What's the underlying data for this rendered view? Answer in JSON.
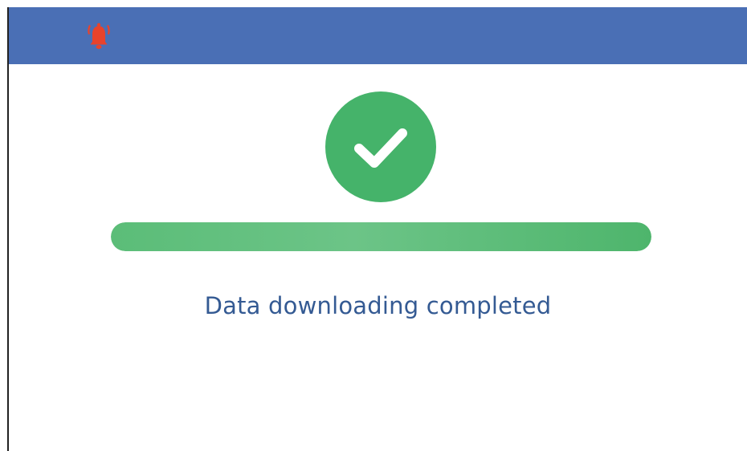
{
  "header": {
    "color": "#4a6fb5",
    "alarm_icon": "bell-ringing-icon",
    "alarm_color": "#e8432c"
  },
  "status": {
    "icon": "checkmark-icon",
    "icon_color": "#45b36a",
    "message": "Data downloading completed"
  },
  "progress": {
    "value": 1.0,
    "color": "#5bbd78"
  }
}
